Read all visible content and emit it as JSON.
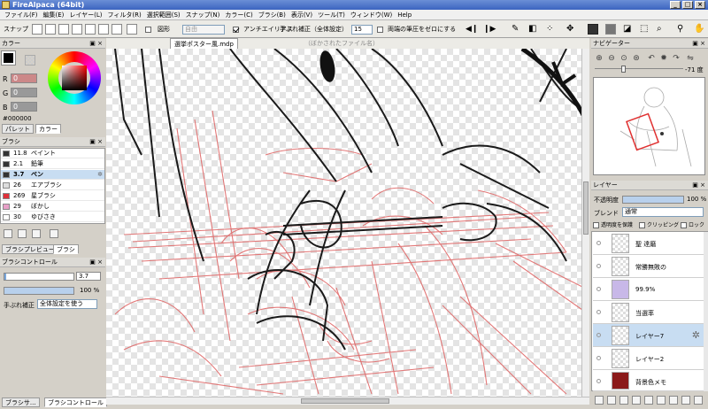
{
  "app": {
    "title": "FireAlpaca (64bit)"
  },
  "menu": [
    "ファイル(F)",
    "編集(E)",
    "レイヤー(L)",
    "フィルタ(R)",
    "選択範囲(S)",
    "スナップ(N)",
    "カラー(C)",
    "ブラシ(B)",
    "表示(V)",
    "ツール(T)",
    "ウィンドウ(W)",
    "Help"
  ],
  "toolbar": {
    "snap_label": "スナップ",
    "shape_label": "図形",
    "shape_value": "自由",
    "antialias_label": "アンチエイリアス",
    "stabilizer_label": "手ぶれ補正（全体設定）",
    "stabilizer_value": "15",
    "zero_pressure_label": "両端の筆圧をゼロにする"
  },
  "document": {
    "tab_active": "選挙ポスター風.mdp",
    "tab_other": "（ぼかされたファイル名）"
  },
  "color_panel": {
    "title": "カラー",
    "r_label": "R",
    "r_value": "0",
    "g_label": "G",
    "g_value": "0",
    "b_label": "B",
    "b_value": "0",
    "hex": "#000000",
    "tab_palette": "パレット",
    "tab_color": "カラー"
  },
  "brush_panel": {
    "title": "ブラシ",
    "items": [
      {
        "size": "11.8",
        "name": "ペイント",
        "swatch": "#333333"
      },
      {
        "size": "2.1",
        "name": "鉛筆",
        "swatch": "#333333"
      },
      {
        "size": "3.7",
        "name": "ペン",
        "swatch": "#333333"
      },
      {
        "size": "26",
        "name": "エアブラシ",
        "swatch": "#dddddd"
      },
      {
        "size": "269",
        "name": "星ブラシ",
        "swatch": "#e0303a"
      },
      {
        "size": "29",
        "name": "ぼかし",
        "swatch": "#e8a0c8"
      },
      {
        "size": "30",
        "name": "ゆびさき",
        "swatch": "#ffffff"
      }
    ],
    "tab_preview": "ブラシプレビュー",
    "tab_brush": "ブラシ"
  },
  "brush_control": {
    "title": "ブラシコントロール",
    "size_value": "3.7",
    "opacity_value": "100 %",
    "stabilizer_label": "手ぶれ補正",
    "stabilizer_value": "全体設定を使う"
  },
  "bottom_tabs": {
    "brush": "ブラシサ...",
    "control": "ブラシコントロール"
  },
  "navigator": {
    "title": "ナビゲーター",
    "angle": "-71 度"
  },
  "layer_panel": {
    "title": "レイヤー",
    "opacity_label": "不透明度",
    "opacity_value": "100 %",
    "blend_label": "ブレンド",
    "blend_value": "通常",
    "protect_label": "透明度を保護",
    "clipping_label": "クリッピング",
    "lock_label": "ロック",
    "layers": [
      {
        "name": "聖 達磨"
      },
      {
        "name": "常勝無敗の"
      },
      {
        "name": "99.9%"
      },
      {
        "name": "当選率"
      },
      {
        "name": "レイヤー7"
      },
      {
        "name": "レイヤー2"
      },
      {
        "name": "背景色メモ"
      }
    ]
  },
  "colors": {
    "accent": "#3c64c0",
    "sketch_red": "#e06a6a",
    "line": "#1a1a1a"
  }
}
